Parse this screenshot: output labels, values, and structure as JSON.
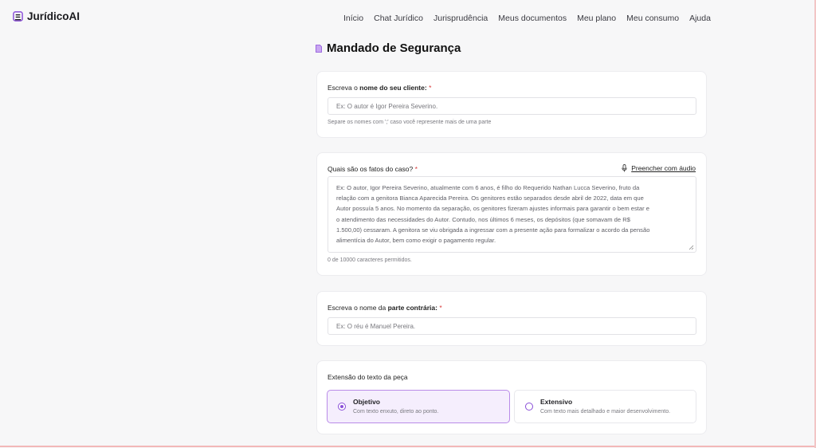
{
  "app": {
    "name": "JurídicoAI"
  },
  "nav": [
    "Início",
    "Chat Jurídico",
    "Jurisprudência",
    "Meus documentos",
    "Meu plano",
    "Meu consumo",
    "Ajuda"
  ],
  "page": {
    "title": "Mandado de Segurança"
  },
  "client": {
    "label_pre": "Escreva o ",
    "label_bold": "nome do seu cliente:",
    "required_mark": "*",
    "placeholder": "Ex: O autor é Igor Pereira Severino.",
    "hint": "Separe os nomes com ';' caso você represente mais de uma parte"
  },
  "facts": {
    "label": "Quais são os fatos do caso?",
    "required_mark": "*",
    "audio_label": "Preencher com áudio",
    "placeholder_lines": [
      "Ex: O autor, Igor Pereira Severino, atualmente com 6 anos, é filho do Requerido Nathan Lucca Severino, fruto da",
      "relação com a genitora Bianca Aparecida Pereira. Os genitores estão separados desde abril de 2022, data em que",
      "Autor possuía 5 anos. No momento da separação, os genitores fizeram ajustes informais para garantir o bem estar e",
      "o atendimento das necessidades do Autor. Contudo, nos últimos 6 meses, os depósitos (que somavam de R$",
      "1.500,00) cessaram. A genitora se viu obrigada a ingressar com a presente ação para formalizar o acordo da pensão",
      "alimentícia do Autor, bem como exigir o pagamento regular."
    ],
    "counter": "0 de 10000 caracteres permitidos."
  },
  "opposing": {
    "label_pre": "Escreva o nome da ",
    "label_bold": "parte contrária:",
    "required_mark": "*",
    "placeholder": "Ex: O réu é Manuel Pereira."
  },
  "extension": {
    "label": "Extensão do texto da peça",
    "options": [
      {
        "title": "Objetivo",
        "desc": "Com texto enxuto, direto ao ponto.",
        "selected": true
      },
      {
        "title": "Extensivo",
        "desc": "Com texto mais detalhado e maior desenvolvimento.",
        "selected": false
      }
    ]
  },
  "colors": {
    "accent": "#8a4fd8",
    "required": "#d93a3a"
  }
}
